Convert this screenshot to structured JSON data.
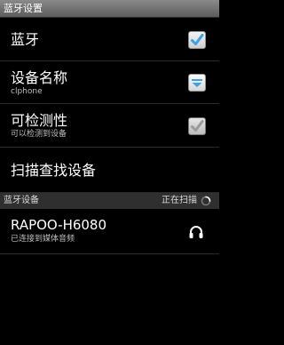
{
  "titlebar": {
    "title": "蓝牙设置"
  },
  "preferences": {
    "bluetooth": {
      "title": "蓝牙",
      "checked": true
    },
    "device_name": {
      "title": "设备名称",
      "summary": "clphone"
    },
    "discoverable": {
      "title": "可检测性",
      "summary": "可以检测到设备",
      "checked": true
    },
    "scan": {
      "title": "扫描查找设备"
    }
  },
  "devices_section": {
    "label": "蓝牙设备",
    "status": "正在扫描"
  },
  "devices": [
    {
      "name": "RAPOO-H6080",
      "status": "已连接到媒体音频",
      "icon": "headset-icon"
    }
  ],
  "colors": {
    "accent_blue": "#3aa3e8",
    "checkbox_grey": "#9a9a9a"
  }
}
